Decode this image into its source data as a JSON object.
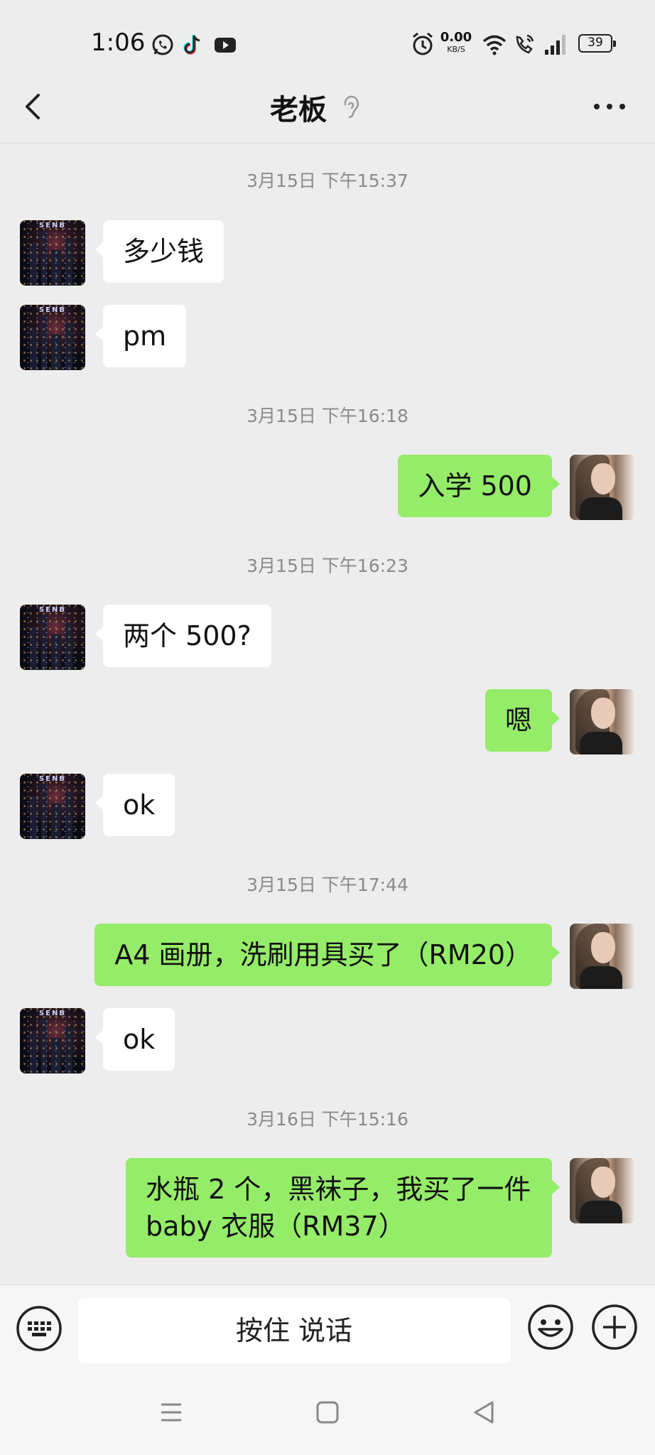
{
  "status_bar": {
    "time": "1:06",
    "net_speed_value": "0.00",
    "net_speed_unit": "KB/S",
    "battery": "39",
    "icons": [
      "whatsapp-icon",
      "tiktok-icon",
      "youtube-icon",
      "alarm-icon",
      "wifi-icon",
      "wifi-call-icon",
      "signal-icon",
      "battery-icon"
    ]
  },
  "header": {
    "title": "老板",
    "icons": [
      "back-icon",
      "ear-icon",
      "more-icon"
    ]
  },
  "messages": [
    {
      "type": "timestamp",
      "text": "3月15日 下午15:37"
    },
    {
      "type": "msg",
      "side": "in",
      "text": "多少钱"
    },
    {
      "type": "msg",
      "side": "in",
      "text": "pm"
    },
    {
      "type": "timestamp",
      "text": "3月15日 下午16:18"
    },
    {
      "type": "msg",
      "side": "out",
      "text": "入学 500"
    },
    {
      "type": "timestamp",
      "text": "3月15日 下午16:23"
    },
    {
      "type": "msg",
      "side": "in",
      "text": "两个 500?"
    },
    {
      "type": "msg",
      "side": "out",
      "text": "嗯"
    },
    {
      "type": "msg",
      "side": "in",
      "text": "ok"
    },
    {
      "type": "timestamp",
      "text": "3月15日 下午17:44"
    },
    {
      "type": "msg",
      "side": "out",
      "text": "A4 画册，洗刷用具买了（RM20）"
    },
    {
      "type": "msg",
      "side": "in",
      "text": "ok"
    },
    {
      "type": "timestamp",
      "text": "3月16日 下午15:16"
    },
    {
      "type": "msg",
      "side": "out",
      "lines": [
        "水瓶 2 个，黑袜子，我买了一件",
        "baby 衣服（RM37）"
      ]
    }
  ],
  "avatar_brand": "SENB",
  "input_bar": {
    "hold_to_talk": "按住 说话",
    "icons": [
      "keyboard-icon",
      "emoji-icon",
      "plus-icon"
    ]
  },
  "nav_bar": {
    "icons": [
      "menu-icon",
      "home-icon",
      "back-triangle-icon"
    ]
  },
  "colors": {
    "background": "#ededed",
    "outgoing_bubble": "#95ec69",
    "incoming_bubble": "#ffffff",
    "timestamp_text": "#8a8a8a"
  }
}
